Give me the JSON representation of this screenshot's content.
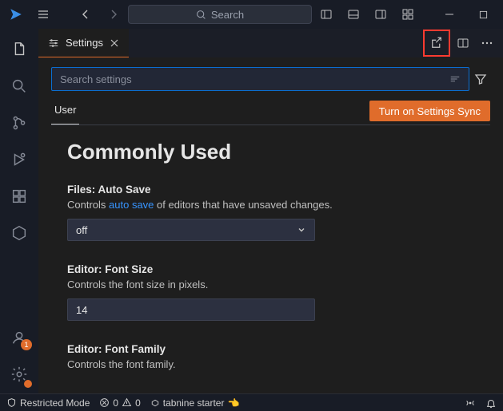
{
  "titlebar": {
    "search_placeholder": "Search"
  },
  "tab": {
    "label": "Settings"
  },
  "settings": {
    "search_placeholder": "Search settings",
    "scope_tab": "User",
    "sync_button": "Turn on Settings Sync",
    "section_heading": "Commonly Used",
    "autosave": {
      "title": "Files: Auto Save",
      "desc_prefix": "Controls ",
      "desc_link": "auto save",
      "desc_suffix": " of editors that have unsaved changes.",
      "value": "off"
    },
    "fontsize": {
      "title": "Editor: Font Size",
      "desc": "Controls the font size in pixels.",
      "value": "14"
    },
    "fontfamily": {
      "title": "Editor: Font Family",
      "desc": "Controls the font family."
    }
  },
  "activity_badge": "1",
  "statusbar": {
    "restricted": "Restricted Mode",
    "errors": "0",
    "warnings": "0",
    "tabnine": "tabnine starter",
    "tabnine_emoji": "👈"
  }
}
